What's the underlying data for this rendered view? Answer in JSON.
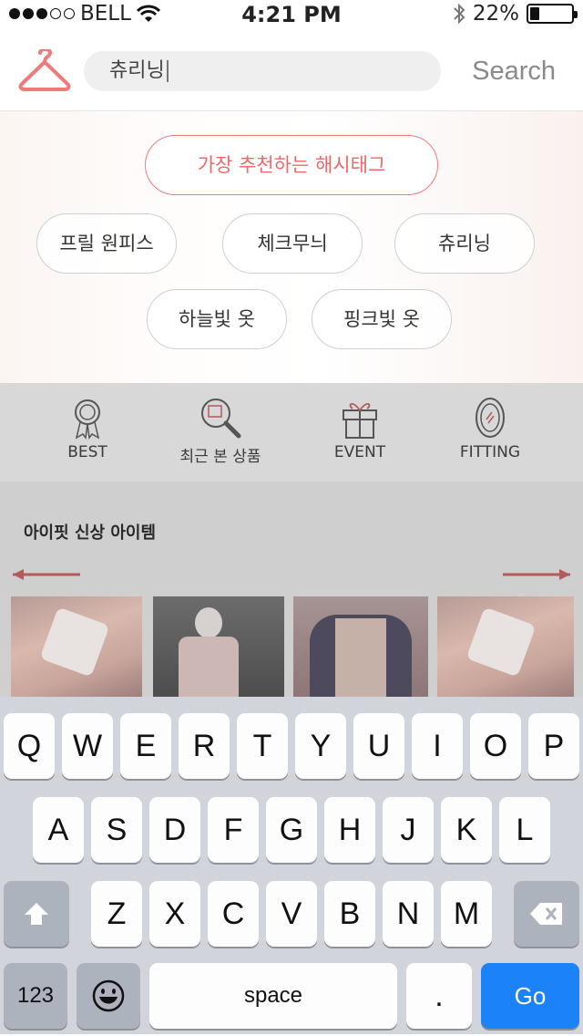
{
  "status_bar": {
    "carrier": "BELL",
    "time": "4:21 PM",
    "battery": "22%",
    "battery_level": 0.22
  },
  "header": {
    "search_value": "츄리닝",
    "search_button": "Search"
  },
  "hashtags": {
    "recommend_label": "가장 추천하는 해시태그",
    "tags": [
      "프릴 원피스",
      "체크무늬",
      "츄리닝",
      "하늘빛 옷",
      "핑크빛 옷"
    ]
  },
  "menu": [
    {
      "label": "BEST",
      "icon": "medal-icon"
    },
    {
      "label": "최근 본 상품",
      "icon": "magnifier-icon"
    },
    {
      "label": "EVENT",
      "icon": "gift-icon"
    },
    {
      "label": "FITTING",
      "icon": "mirror-icon"
    }
  ],
  "new_items": {
    "title": "아이핏 신상 아이템"
  },
  "keyboard": {
    "row1": [
      "Q",
      "W",
      "E",
      "R",
      "T",
      "Y",
      "U",
      "I",
      "O",
      "P"
    ],
    "row2": [
      "A",
      "S",
      "D",
      "F",
      "G",
      "H",
      "J",
      "K",
      "L"
    ],
    "row3": [
      "Z",
      "X",
      "C",
      "V",
      "B",
      "N",
      "M"
    ],
    "num_key": "123",
    "space_key": "space",
    "period_key": ".",
    "go_key": "Go"
  },
  "colors": {
    "accent": "#ee6a6a",
    "go_key": "#1b82f7",
    "keyboard_bg": "#d1d5db"
  }
}
